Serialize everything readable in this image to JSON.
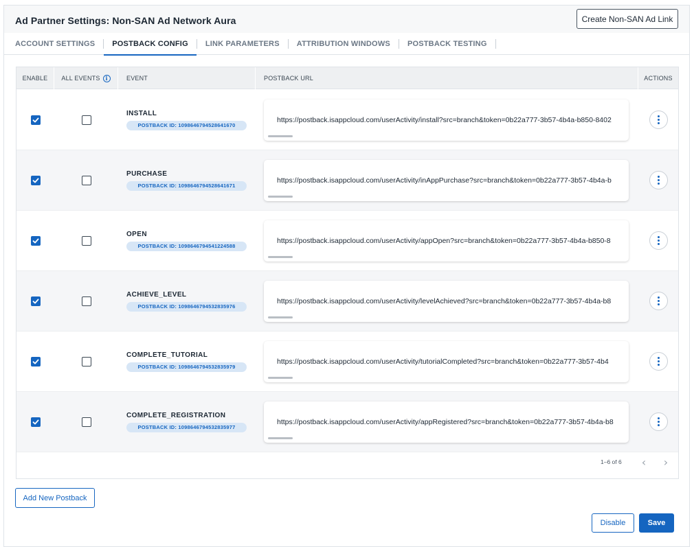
{
  "header": {
    "title": "Ad Partner Settings: Non-SAN Ad Network Aura",
    "create_button": "Create Non-SAN Ad Link"
  },
  "tabs": [
    {
      "label": "ACCOUNT SETTINGS",
      "active": false
    },
    {
      "label": "POSTBACK CONFIG",
      "active": true
    },
    {
      "label": "LINK PARAMETERS",
      "active": false
    },
    {
      "label": "ATTRIBUTION WINDOWS",
      "active": false
    },
    {
      "label": "POSTBACK TESTING",
      "active": false
    }
  ],
  "table": {
    "columns": {
      "enable": "ENABLE",
      "all_events": "ALL EVENTS",
      "info_icon": "info-icon",
      "event": "EVENT",
      "postback_url": "POSTBACK URL",
      "actions": "ACTIONS"
    },
    "rows": [
      {
        "enabled": true,
        "all_events": false,
        "event": "INSTALL",
        "postback_id": "POSTBACK ID: 1098646794528641670",
        "url": "https://postback.isappcloud.com/userActivity/install?src=branch&token=0b22a777-3b57-4b4a-b850-8402"
      },
      {
        "enabled": true,
        "all_events": false,
        "event": "PURCHASE",
        "postback_id": "POSTBACK ID: 1098646794528641671",
        "url": "https://postback.isappcloud.com/userActivity/inAppPurchase?src=branch&token=0b22a777-3b57-4b4a-b"
      },
      {
        "enabled": true,
        "all_events": false,
        "event": "OPEN",
        "postback_id": "POSTBACK ID: 1098646794541224588",
        "url": "https://postback.isappcloud.com/userActivity/appOpen?src=branch&token=0b22a777-3b57-4b4a-b850-8"
      },
      {
        "enabled": true,
        "all_events": false,
        "event": "ACHIEVE_LEVEL",
        "postback_id": "POSTBACK ID: 1098646794532835976",
        "url": "https://postback.isappcloud.com/userActivity/levelAchieved?src=branch&token=0b22a777-3b57-4b4a-b8"
      },
      {
        "enabled": true,
        "all_events": false,
        "event": "COMPLETE_TUTORIAL",
        "postback_id": "POSTBACK ID: 1098646794532835979",
        "url": "https://postback.isappcloud.com/userActivity/tutorialCompleted?src=branch&token=0b22a777-3b57-4b4"
      },
      {
        "enabled": true,
        "all_events": false,
        "event": "COMPLETE_REGISTRATION",
        "postback_id": "POSTBACK ID: 1098646794532835977",
        "url": "https://postback.isappcloud.com/userActivity/appRegistered?src=branch&token=0b22a777-3b57-4b4a-b8"
      }
    ],
    "pagination": {
      "info": "1–6 of 6",
      "prev_icon": "chevron-left-icon",
      "next_icon": "chevron-right-icon"
    }
  },
  "footer": {
    "add_button": "Add New Postback",
    "disable_button": "Disable",
    "save_button": "Save"
  },
  "colors": {
    "accent": "#1565c0",
    "badge_bg": "#d7e6f6",
    "header_bg": "#eef0f2"
  }
}
